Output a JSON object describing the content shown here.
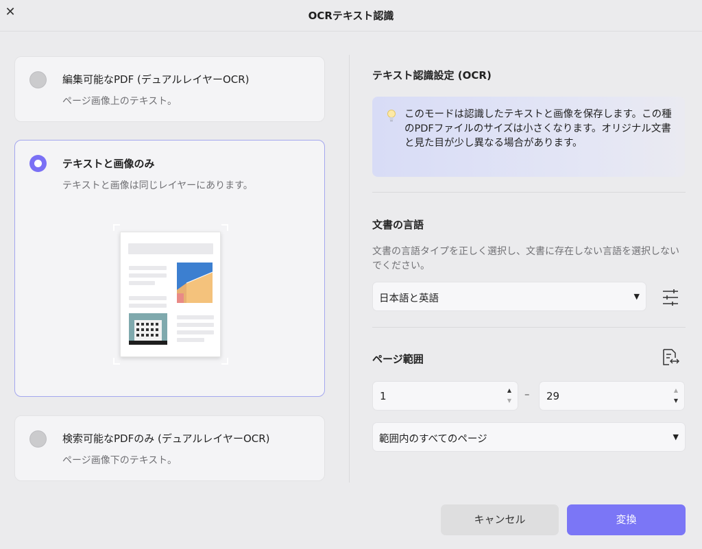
{
  "window": {
    "title": "OCRテキスト認識",
    "close_glyph": "✕"
  },
  "options": [
    {
      "title": "編集可能なPDF (デュアルレイヤーOCR)",
      "subtitle": "ページ画像上のテキスト。",
      "selected": false
    },
    {
      "title": "テキストと画像のみ",
      "subtitle": "テキストと画像は同じレイヤーにあります。",
      "selected": true
    },
    {
      "title": "検索可能なPDFのみ (デュアルレイヤーOCR)",
      "subtitle": "ページ画像下のテキスト。",
      "selected": false
    }
  ],
  "settings": {
    "heading": "テキスト認識設定 (OCR)",
    "info_icon": "lightbulb-icon",
    "info_text": "このモードは認識したテキストと画像を保存します。この種のPDFファイルのサイズは小さくなります。オリジナル文書と見た目が少し異なる場合があります。",
    "language": {
      "heading": "文書の言語",
      "description": "文書の言語タイプを正しく選択し、文書に存在しない言語を選択しないでください。",
      "selected": "日本語と英語",
      "settings_icon": "sliders-icon"
    },
    "page_range": {
      "heading": "ページ範囲",
      "icon": "page-swap-icon",
      "from": "1",
      "to": "29",
      "separator": "–",
      "range_selected": "範囲内のすべてのページ"
    }
  },
  "buttons": {
    "cancel": "キャンセル",
    "convert": "変換"
  },
  "colors": {
    "accent": "#7b76f6",
    "selected_border": "#a3a6ee",
    "info_bg": "#d8dcf6"
  }
}
